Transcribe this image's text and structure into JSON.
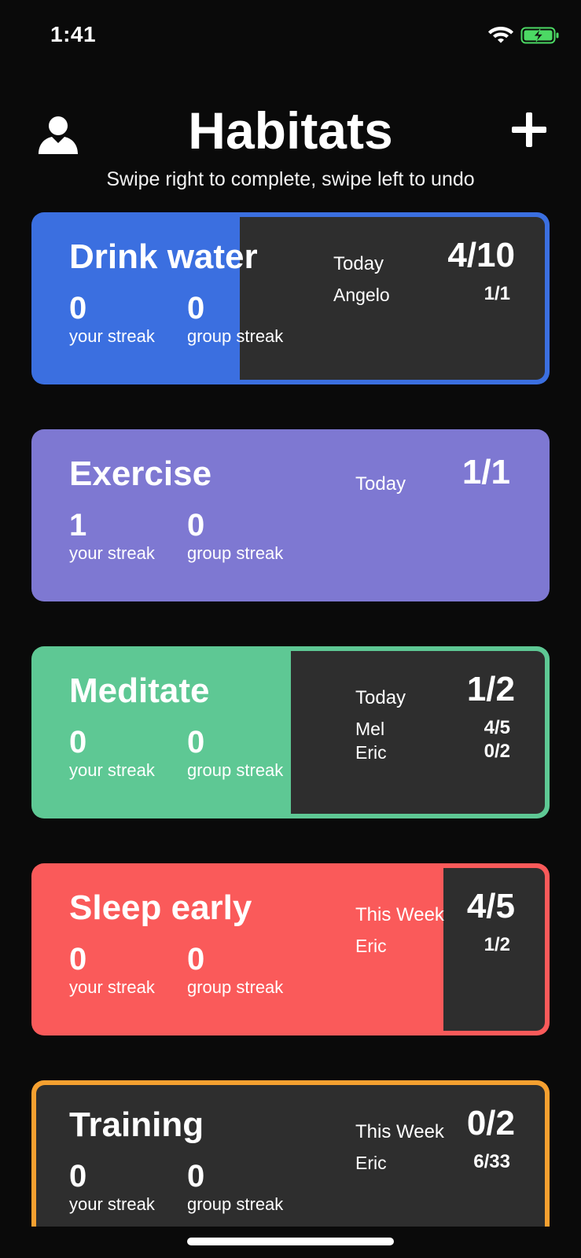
{
  "status_bar": {
    "time": "1:41",
    "wifi_icon": "wifi-icon",
    "battery_icon": "battery-charging-icon"
  },
  "header": {
    "title": "Habitats",
    "subtitle": "Swipe right to complete, swipe left to undo",
    "profile_icon": "person-icon",
    "add_icon": "plus-icon"
  },
  "habits": [
    {
      "name": "Drink water",
      "color": "#3b6fe0",
      "your_streak": "0",
      "your_streak_label": "your streak",
      "group_streak": "0",
      "group_streak_label": "group streak",
      "progress": 0.4,
      "period": "Today",
      "period_value": "4/10",
      "members": [
        {
          "name": "Angelo",
          "value": "1/1"
        }
      ]
    },
    {
      "name": "Exercise",
      "color": "#7e78d2",
      "your_streak": "1",
      "your_streak_label": "your streak",
      "group_streak": "0",
      "group_streak_label": "group streak",
      "progress": 1.0,
      "period": "Today",
      "period_value": "1/1",
      "members": []
    },
    {
      "name": "Meditate",
      "color": "#5ec894",
      "your_streak": "0",
      "your_streak_label": "your streak",
      "group_streak": "0",
      "group_streak_label": "group streak",
      "progress": 0.5,
      "period": "Today",
      "period_value": "1/2",
      "members": [
        {
          "name": "Mel",
          "value": "4/5"
        },
        {
          "name": "Eric",
          "value": "0/2"
        }
      ]
    },
    {
      "name": "Sleep early",
      "color": "#fa5a5a",
      "your_streak": "0",
      "your_streak_label": "your streak",
      "group_streak": "0",
      "group_streak_label": "group streak",
      "progress": 0.8,
      "period": "This Week",
      "period_value": "4/5",
      "members": [
        {
          "name": "Eric",
          "value": "1/2"
        }
      ]
    },
    {
      "name": "Training",
      "color": "#f5a030",
      "your_streak": "0",
      "your_streak_label": "your streak",
      "group_streak": "0",
      "group_streak_label": "group streak",
      "progress": 0.0,
      "period": "This Week",
      "period_value": "0/2",
      "members": [
        {
          "name": "Eric",
          "value": "6/33"
        }
      ]
    }
  ]
}
